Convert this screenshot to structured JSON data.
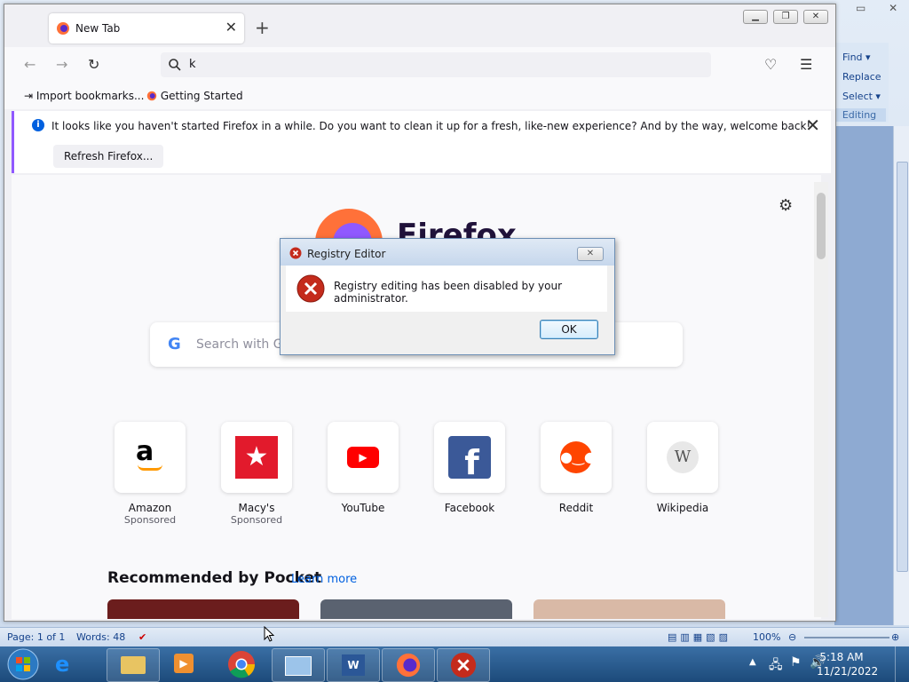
{
  "word": {
    "ribbon": {
      "find": "Find",
      "replace": "Replace",
      "select": "Select",
      "group_label": "Editing"
    },
    "status": {
      "page": "Page: 1 of 1",
      "words": "Words: 48",
      "zoom": "100%"
    }
  },
  "firefox": {
    "tab_title": "New Tab",
    "url_value": "k",
    "bookmarks": [
      "Import bookmarks...",
      "Getting Started"
    ],
    "notification": {
      "message": "It looks like you haven't started Firefox in a while. Do you want to clean it up for a fresh, like-new experience? And by the way, welcome back!",
      "button": "Refresh Firefox..."
    },
    "logo_text": "Firefox",
    "search_placeholder": "Search with Go",
    "shortcuts": [
      {
        "name": "Amazon",
        "sponsored": "Sponsored",
        "icon": "amazon-icon",
        "color": "#000000"
      },
      {
        "name": "Macy's",
        "sponsored": "Sponsored",
        "icon": "macys-star-icon",
        "color": "#e21a2c"
      },
      {
        "name": "YouTube",
        "sponsored": "",
        "icon": "youtube-icon",
        "color": "#ff0000"
      },
      {
        "name": "Facebook",
        "sponsored": "",
        "icon": "facebook-icon",
        "color": "#3b5998"
      },
      {
        "name": "Reddit",
        "sponsored": "",
        "icon": "reddit-icon",
        "color": "#ff4500"
      },
      {
        "name": "Wikipedia",
        "sponsored": "",
        "icon": "wikipedia-icon",
        "color": "#888888"
      }
    ],
    "pocket": {
      "title": "Recommended by Pocket",
      "link": "Learn more"
    }
  },
  "dialog": {
    "title": "Registry Editor",
    "message": "Registry editing has been disabled by your administrator.",
    "ok": "OK"
  },
  "taskbar": {
    "time": "5:18 AM",
    "date": "11/21/2022",
    "items": [
      "internet-explorer-icon",
      "file-explorer-icon",
      "media-player-icon",
      "chrome-icon",
      "control-panel-icon",
      "word-icon",
      "firefox-icon",
      "error-icon"
    ]
  }
}
